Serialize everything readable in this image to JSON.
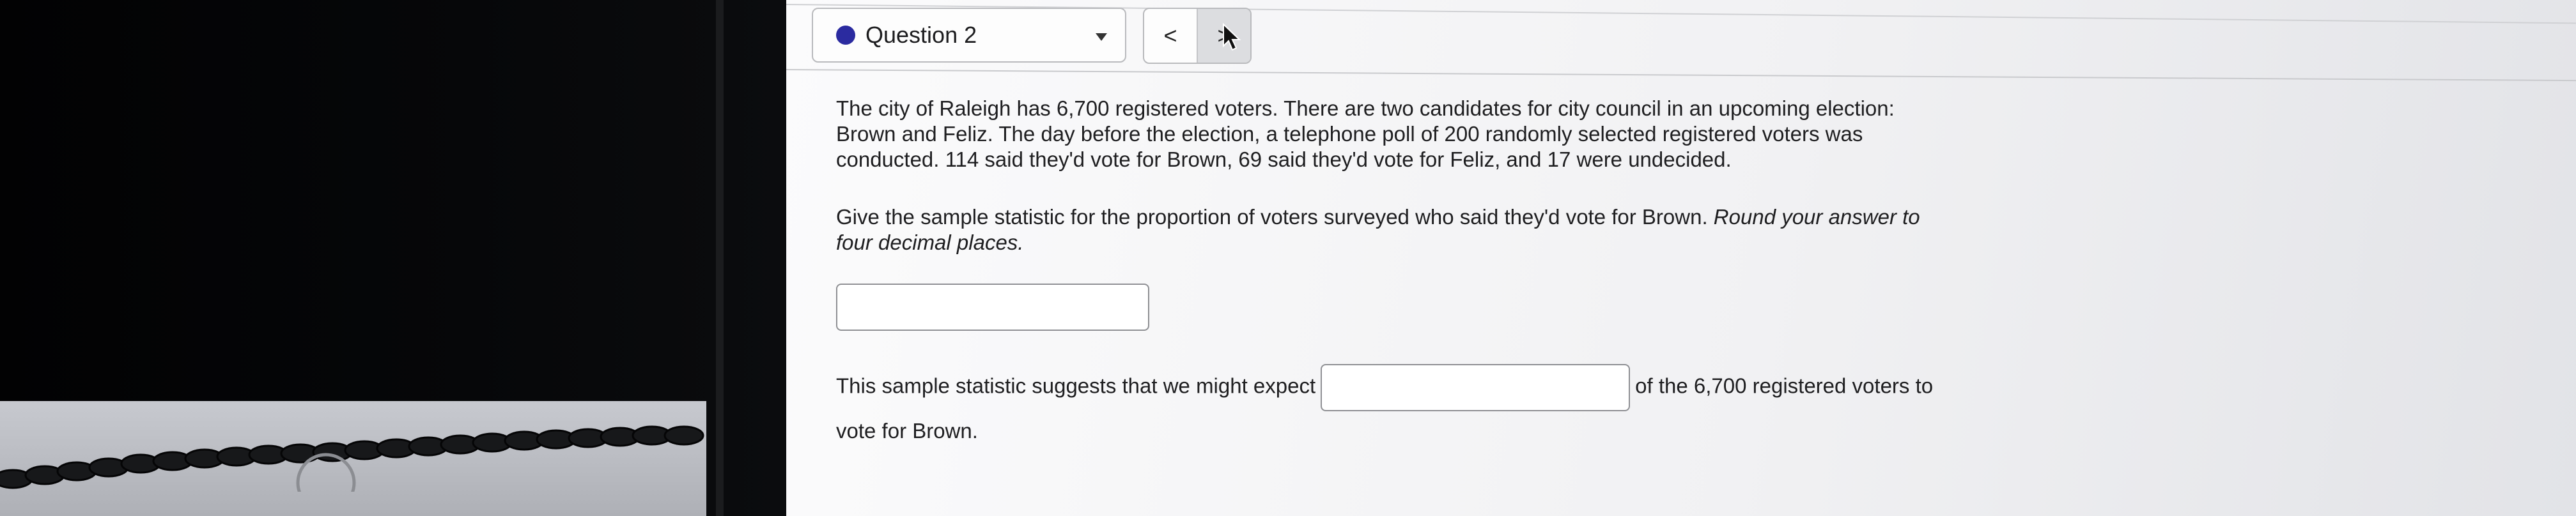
{
  "header": {
    "question_label": "Question 2",
    "prev_label": "<",
    "next_label": ">"
  },
  "problem": {
    "paragraph": "The city of Raleigh has 6,700 registered voters. There are two candidates for city council in an upcoming election: Brown and Feliz. The day before the election, a telephone poll of 200 randomly selected registered voters was conducted. 114 said they'd vote for Brown, 69 said they'd vote for Feliz, and 17 were undecided.",
    "prompt_main": "Give the sample statistic for the proportion of voters surveyed who said they'd vote for Brown.",
    "prompt_italic": "Round your answer to four decimal places.",
    "answer1_value": "",
    "followup_before": "This sample statistic suggests that we might expect",
    "answer2_value": "",
    "followup_after": "of the 6,700 registered voters to vote for Brown."
  },
  "icons": {
    "status": "status-dot-icon",
    "dropdown": "chevron-down-icon",
    "cursor": "mouse-pointer-icon"
  },
  "colors": {
    "status_dot": "#2b2ba0"
  }
}
